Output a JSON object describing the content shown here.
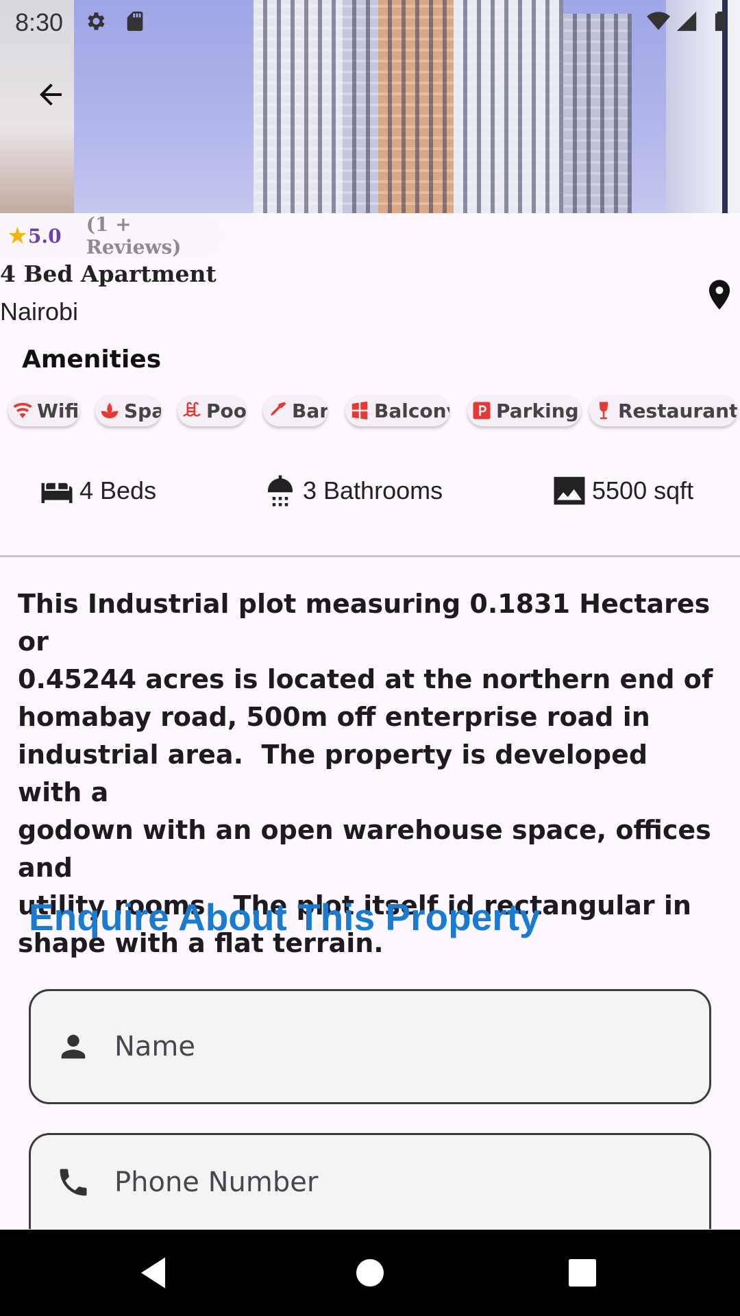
{
  "status": {
    "time": "8:30",
    "icons": [
      "settings-icon",
      "sd-card-icon",
      "wifi-icon",
      "signal-icon",
      "battery-icon"
    ]
  },
  "header": {
    "back_icon": "arrow-back-icon"
  },
  "rating": {
    "score": "5.0",
    "reviews": "(1 + Reviews)"
  },
  "property": {
    "title": "4 Bed Apartment",
    "location": "Nairobi",
    "pin_icon": "location-pin-icon"
  },
  "amenities": {
    "heading": "Amenities",
    "items": [
      {
        "label": "Wifi",
        "icon": "wifi-icon"
      },
      {
        "label": "Spa",
        "icon": "spa-icon"
      },
      {
        "label": "Pool",
        "icon": "pool-icon"
      },
      {
        "label": "Bar",
        "icon": "bar-icon"
      },
      {
        "label": "Balcony",
        "icon": "balcony-icon"
      },
      {
        "label": "Parking",
        "icon": "parking-icon"
      },
      {
        "label": "Restaurant",
        "icon": "restaurant-icon"
      }
    ]
  },
  "specs": {
    "beds": "4 Beds",
    "bathrooms": "3 Bathrooms",
    "area": "5500 sqft"
  },
  "description": "This Industrial plot measuring 0.1831 Hectares or\n0.45244 acres is located at the northern end of\nhomabay road, 500m off enterprise road in\nindustrial area.  The property is developed with a\ngodown with an open warehouse space, offices and\nutility rooms.  The plot itself id rectangular in\nshape with a flat terrain.",
  "enquiry": {
    "heading": "Enquire About This Property",
    "name_placeholder": "Name",
    "phone_placeholder": "Phone Number"
  },
  "colors": {
    "accent": "#1a7bd0",
    "rating_star": "#f4b400",
    "rating_score": "#6c3fb0",
    "amenity_icon": "#e53935"
  }
}
